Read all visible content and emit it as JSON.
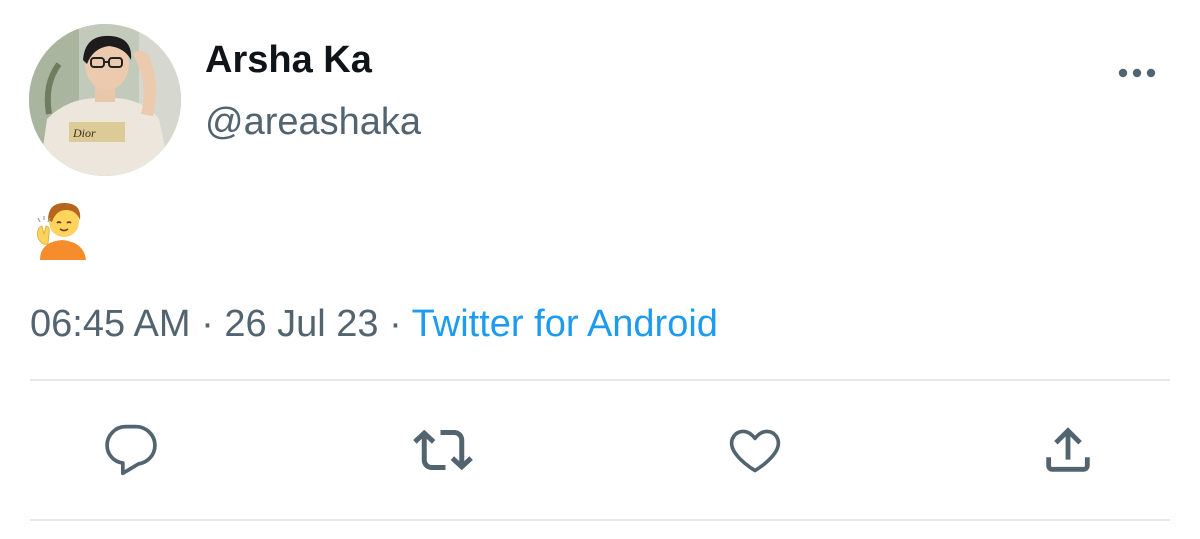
{
  "tweet": {
    "author": {
      "display_name": "Arsha Ka",
      "handle": "@areashaka"
    },
    "content": {
      "emoji": "🙋 (person raising hand emoji)"
    },
    "time": "06:45 AM",
    "separator": " · ",
    "date": "26 Jul 23",
    "source": "Twitter for Android"
  },
  "icons": {
    "more": "more-horizontal-icon",
    "reply": "reply-icon",
    "retweet": "retweet-icon",
    "like": "heart-icon",
    "share": "share-icon"
  },
  "colors": {
    "text_primary": "#0f1419",
    "text_secondary": "#536471",
    "accent": "#1d9bf0",
    "divider": "#e6e9eb"
  }
}
